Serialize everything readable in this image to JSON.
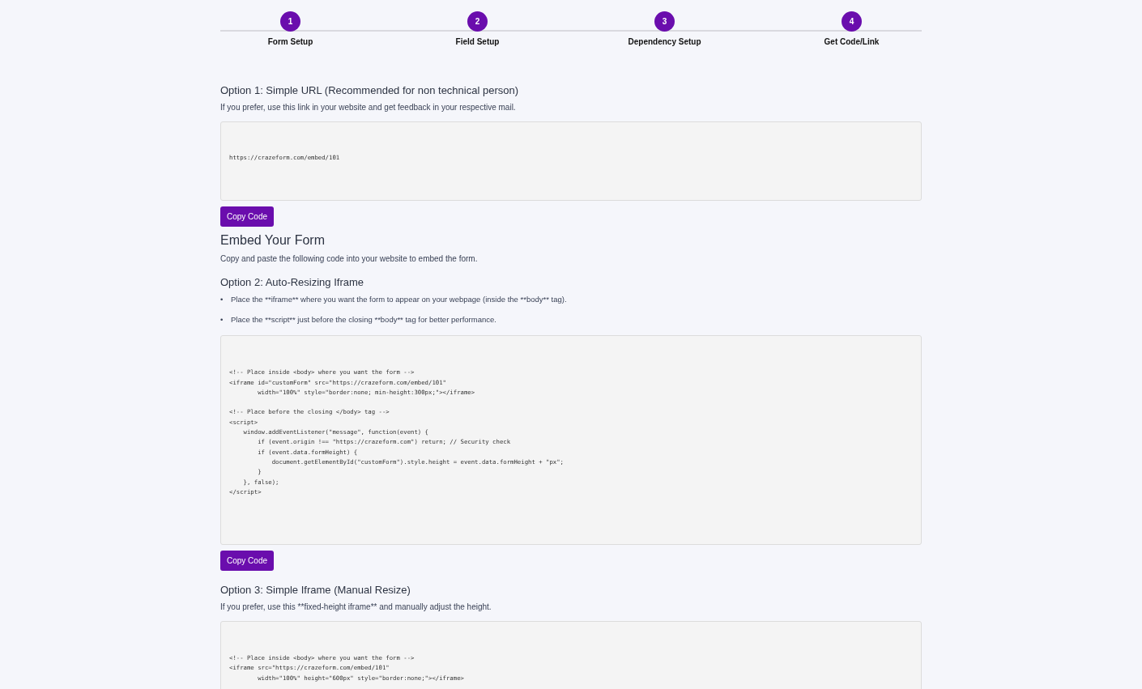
{
  "steps": [
    {
      "number": "1",
      "label": "Form Setup",
      "selected": true
    },
    {
      "number": "2",
      "label": "Field Setup",
      "selected": true
    },
    {
      "number": "3",
      "label": "Dependency Setup",
      "selected": true
    },
    {
      "number": "4",
      "label": "Get Code/Link",
      "selected": true
    }
  ],
  "sections": [
    {
      "kind": "option",
      "heading": "Option 1: Simple URL (Recommended for non technical person)",
      "text": "If you prefer, use this link in your website and get feedback in your respective mail.",
      "code": "https://crazeform.com/embed/101",
      "button": "Copy Code"
    },
    {
      "kind": "title",
      "heading": "Embed Your Form",
      "text": "Copy and paste the following code into your website to embed the form."
    },
    {
      "kind": "option",
      "heading": "Option 2: Auto-Resizing Iframe",
      "bullet_marker": "•",
      "bullets": [
        "Place the **iframe** where you want the form to appear on your webpage (inside the **body** tag).",
        "Place the **script** just before the closing **body** tag for better performance."
      ],
      "code": "<!-- Place inside <body> where you want the form -->\n<iframe id=\"customForm\" src=\"https://crazeform.com/embed/101\"\n        width=\"100%\" style=\"border:none; min-height:300px;\"></iframe>\n\n<!-- Place before the closing </body> tag -->\n<script>\n    window.addEventListener(\"message\", function(event) {\n        if (event.origin !== \"https://crazeform.com\") return; // Security check\n        if (event.data.formHeight) {\n            document.getElementById(\"customForm\").style.height = event.data.formHeight + \"px\";\n        }\n    }, false);\n</script>",
      "button": "Copy Code"
    },
    {
      "kind": "option",
      "heading": "Option 3: Simple Iframe (Manual Resize)",
      "text": "If you prefer, use this **fixed-height iframe** and manually adjust the height.",
      "code": "<!-- Place inside <body> where you want the form -->\n<iframe src=\"https://crazeform.com/embed/101\"\n        width=\"100%\" height=\"600px\" style=\"border:none;\"></iframe>"
    }
  ]
}
